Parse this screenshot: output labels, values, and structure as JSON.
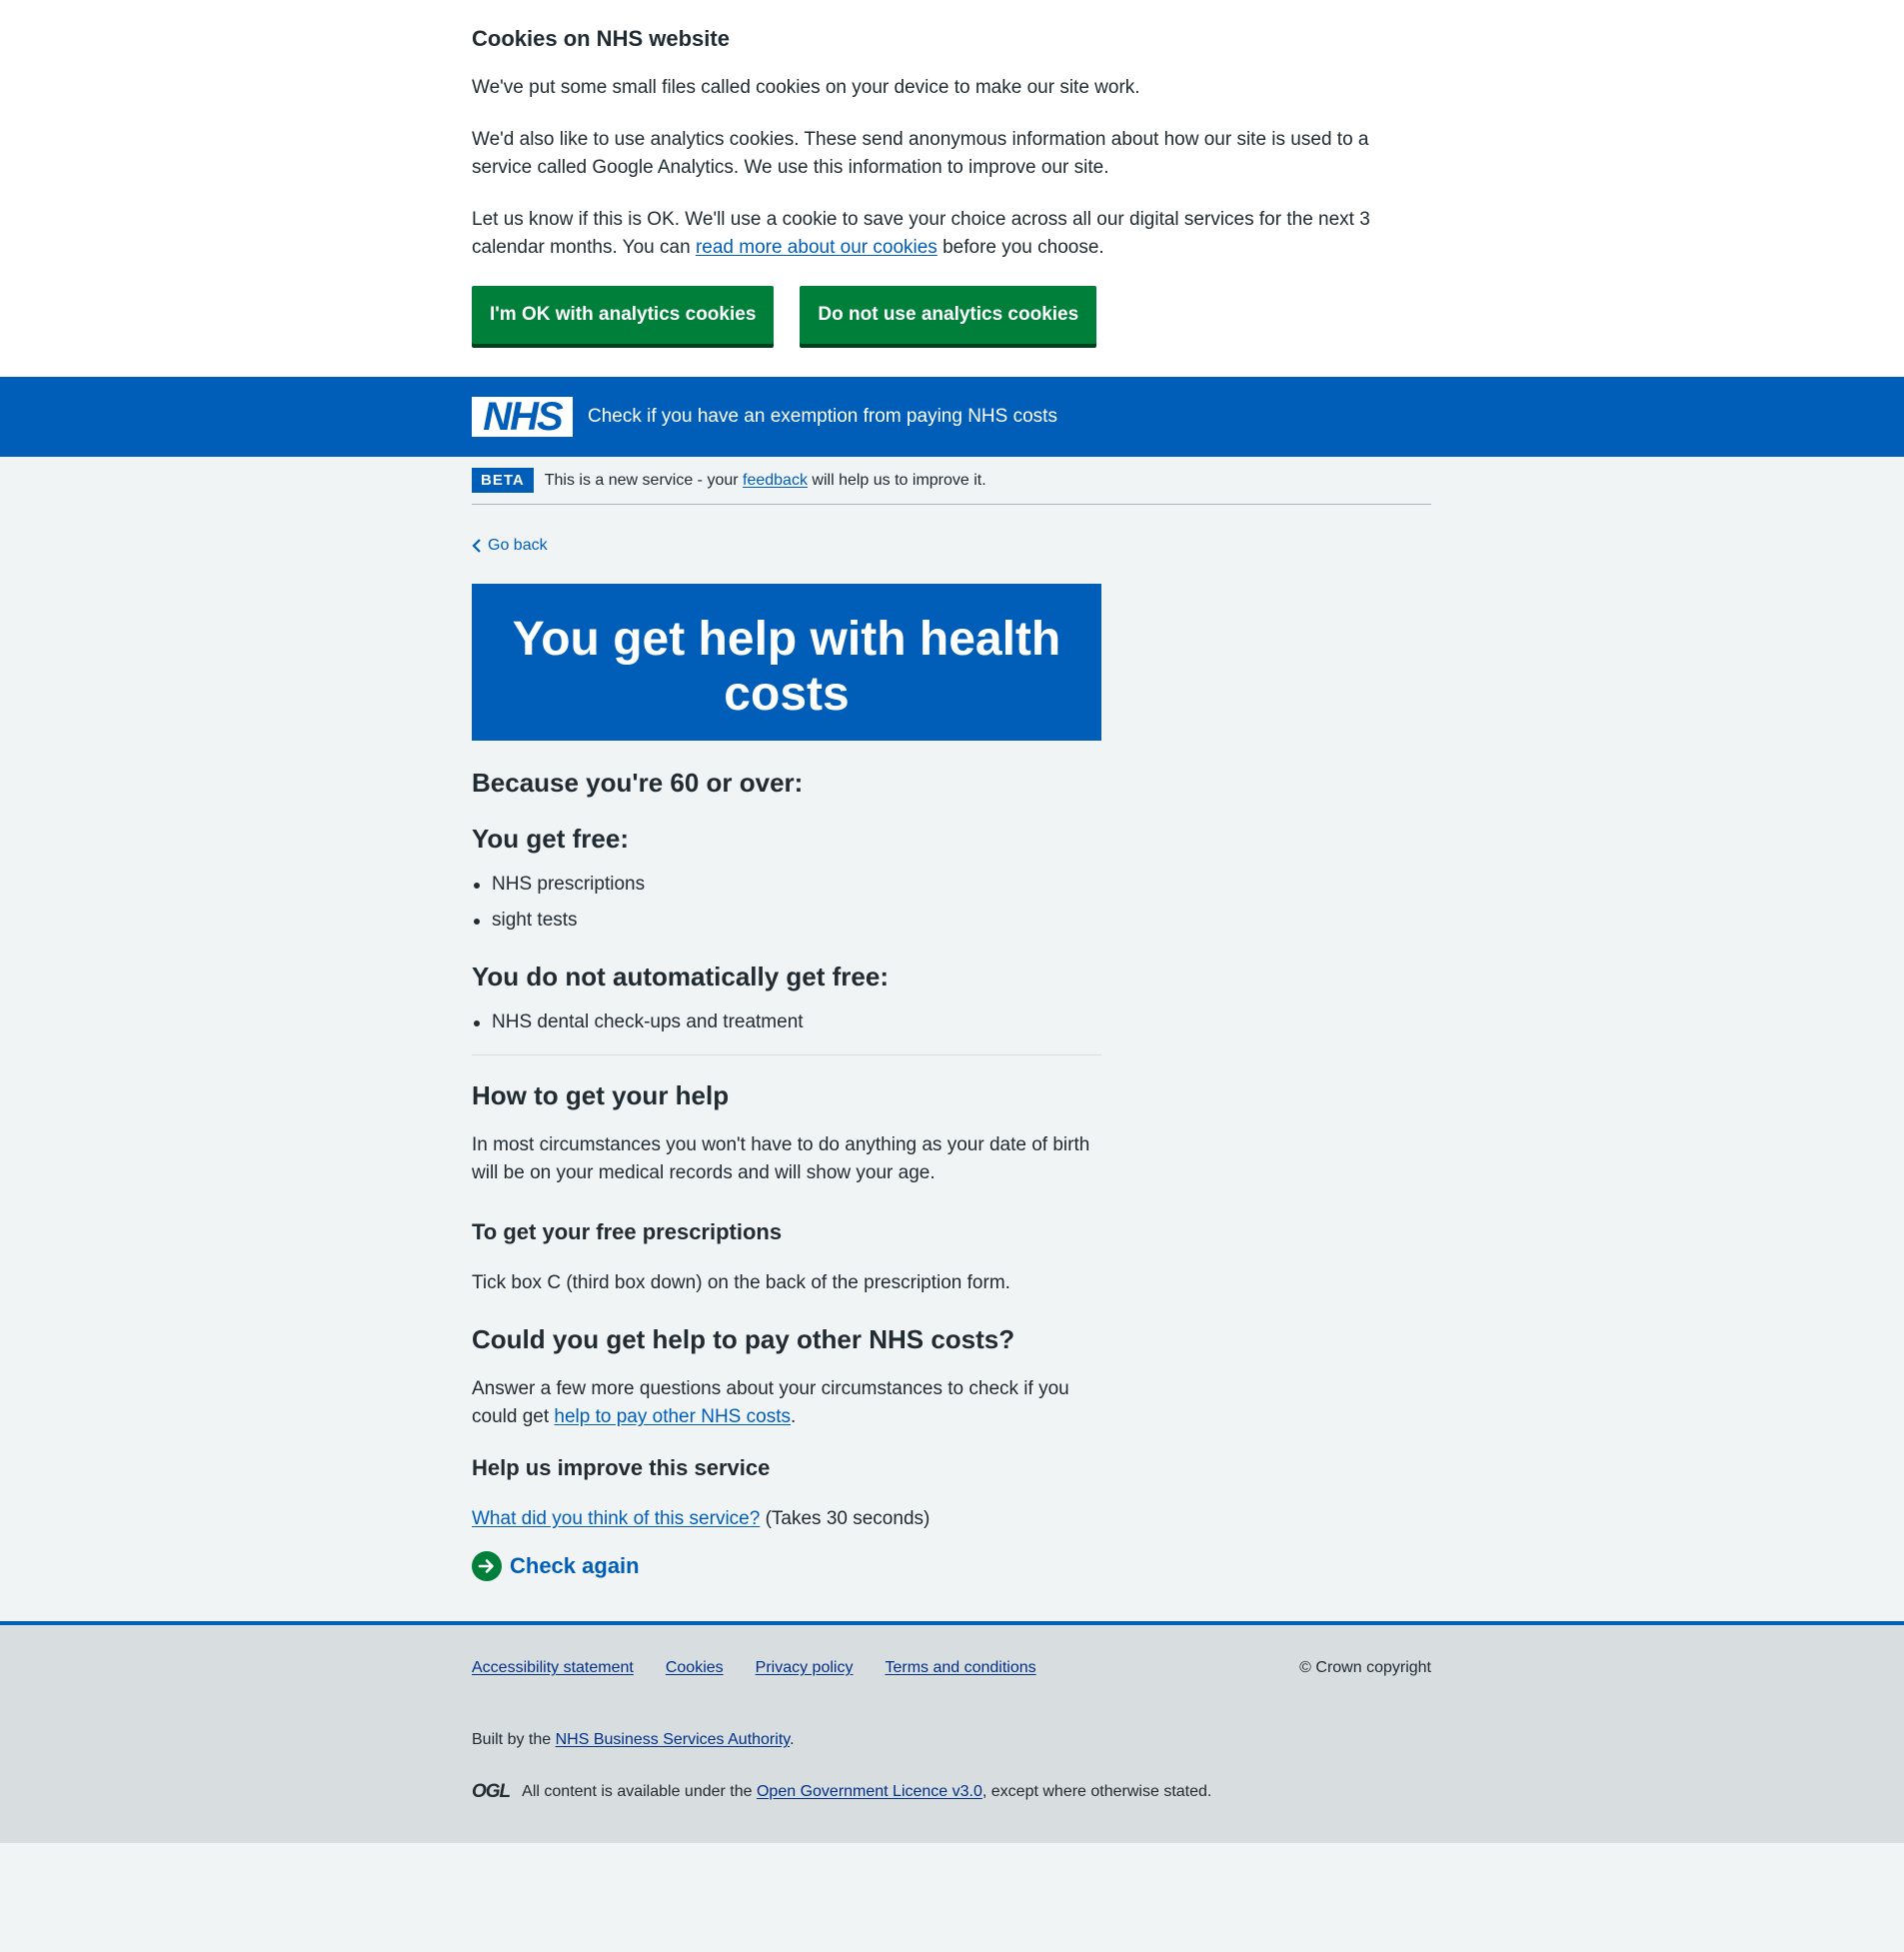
{
  "cookie_banner": {
    "title": "Cookies on NHS website",
    "p1": "We've put some small files called cookies on your device to make our site work.",
    "p2": "We'd also like to use analytics cookies. These send anonymous information about how our site is used to a service called Google Analytics. We use this information to improve our site.",
    "p3_before": "Let us know if this is OK. We'll use a cookie to save your choice across all our digital services for the next 3 calendar months. You can ",
    "p3_link": "read more about our cookies",
    "p3_after": " before you choose.",
    "accept_label": "I'm OK with analytics cookies",
    "reject_label": "Do not use analytics cookies"
  },
  "header": {
    "logo_text": "NHS",
    "service_name": "Check if you have an exemption from paying NHS costs"
  },
  "beta": {
    "tag": "BETA",
    "text_before": "This is a new service - your ",
    "link": "feedback",
    "text_after": " will help us to improve it."
  },
  "main": {
    "back_label": "Go back",
    "panel_title": "You get help with health costs",
    "because": "Because you're 60 or over:",
    "free_heading": "You get free:",
    "free_items": [
      "NHS prescriptions",
      "sight tests"
    ],
    "not_free_heading": "You do not automatically get free:",
    "not_free_items": [
      "NHS dental check-ups and treatment"
    ],
    "how_heading": "How to get your help",
    "how_text": "In most circumstances you won't have to do anything as your date of birth will be on your medical records and will show your age.",
    "prescriptions_heading": "To get your free prescriptions",
    "prescriptions_text": "Tick box C (third box down) on the back of the prescription form.",
    "other_heading": "Could you get help to pay other NHS costs?",
    "other_text_before": "Answer a few more questions about your circumstances to check if you could get ",
    "other_link": "help to pay other NHS costs",
    "other_text_after": ".",
    "improve_heading": "Help us improve this service",
    "improve_link": "What did you think of this service?",
    "improve_after": " (Takes 30 seconds)",
    "check_again": "Check again"
  },
  "footer": {
    "links": [
      "Accessibility statement",
      "Cookies",
      "Privacy policy",
      "Terms and conditions"
    ],
    "copyright": "© Crown copyright",
    "built_before": "Built by the ",
    "built_link": "NHS Business Services Authority",
    "built_after": ".",
    "ogl_mark": "OGL",
    "licence_before": "All content is available under the ",
    "licence_link": "Open Government Licence v3.0",
    "licence_after": ", except where otherwise stated."
  },
  "colors": {
    "nhs_blue": "#005eb8",
    "nhs_green": "#007f3b",
    "page_bg": "#f0f4f5",
    "footer_bg": "#d8dde0"
  }
}
